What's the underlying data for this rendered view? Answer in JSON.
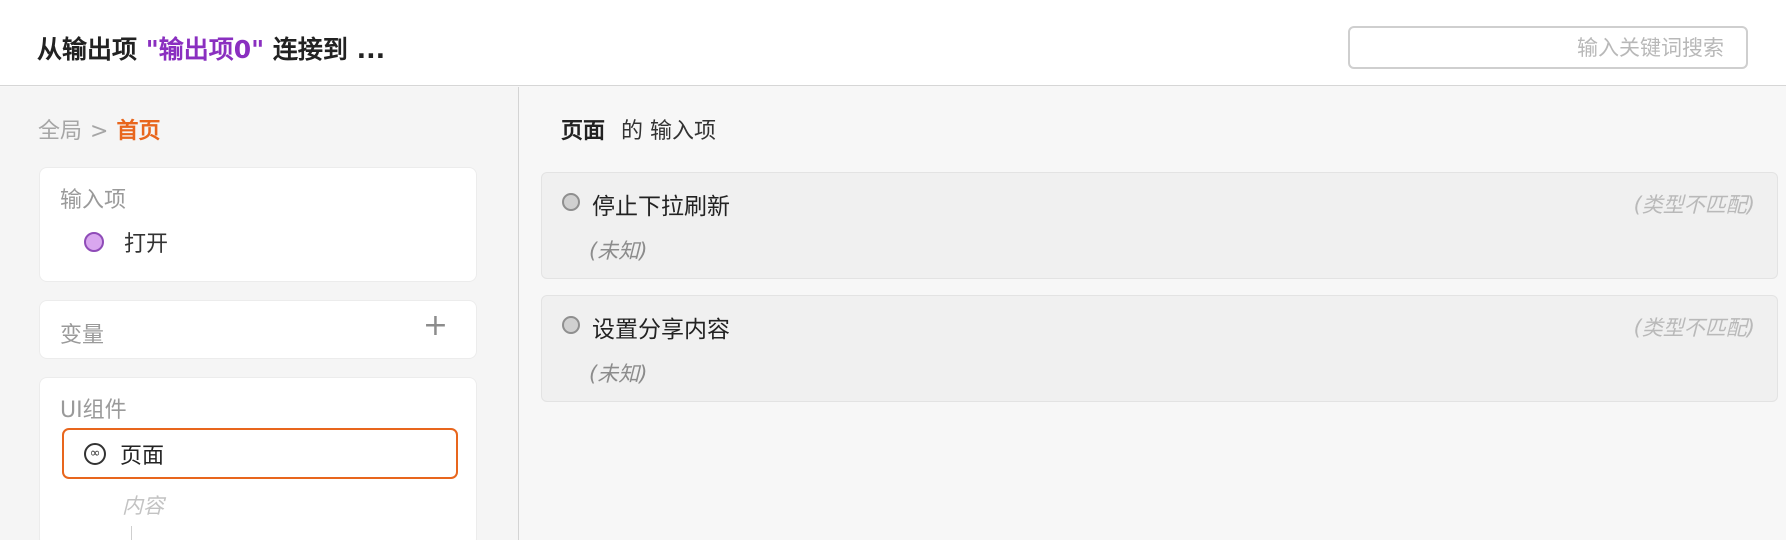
{
  "header": {
    "title_prefix": "从输出项",
    "title_highlight": "\"输出项0\"",
    "title_suffix": "连接到 ...",
    "search_placeholder": "输入关键词搜索"
  },
  "breadcrumb": {
    "root": "全局",
    "separator": ">",
    "current": "首页"
  },
  "left": {
    "inputs": {
      "title": "输入项",
      "items": [
        {
          "label": "打开",
          "dot_color": "#d9a7ef"
        }
      ]
    },
    "variables": {
      "title": "变量",
      "add_icon": "+"
    },
    "ui_components": {
      "title": "UI组件",
      "selected": {
        "label": "页面",
        "icon": "link-icon"
      },
      "child": "内容"
    }
  },
  "right": {
    "object_name": "页面",
    "suffix": "的 输入项",
    "ports": [
      {
        "name": "停止下拉刷新",
        "status": "(类型不匹配)",
        "type": "(未知)"
      },
      {
        "name": "设置分享内容",
        "status": "(类型不匹配)",
        "type": "(未知)"
      }
    ]
  },
  "colors": {
    "accent": "#e8661d",
    "highlight": "#8a2fc0"
  }
}
